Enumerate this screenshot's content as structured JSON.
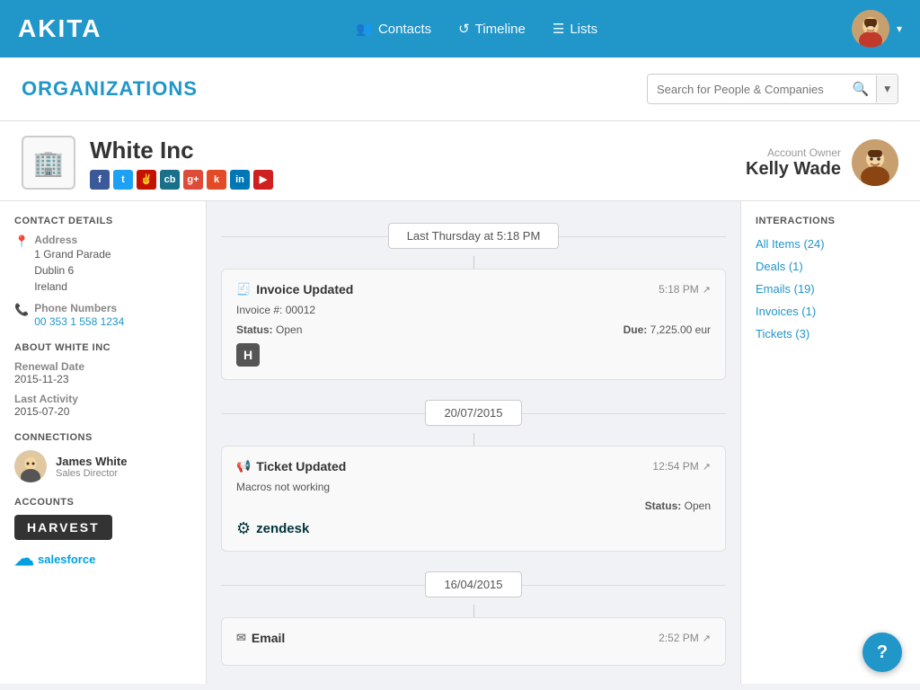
{
  "nav": {
    "logo": "AKITA",
    "links": [
      {
        "label": "Contacts",
        "icon": "👥"
      },
      {
        "label": "Timeline",
        "icon": "↺"
      },
      {
        "label": "Lists",
        "icon": "☰"
      }
    ]
  },
  "header": {
    "page_title": "ORGANIZATIONS",
    "search_placeholder": "Search for People & Companies"
  },
  "company": {
    "name": "White Inc",
    "icon": "🏢",
    "account_owner_label": "Account Owner",
    "account_owner": "Kelly Wade"
  },
  "left_sidebar": {
    "contact_details_title": "CONTACT DETAILS",
    "address_label": "Address",
    "address_line1": "1 Grand Parade",
    "address_line2": "Dublin 6",
    "address_line3": "Ireland",
    "phone_label": "Phone Numbers",
    "phone_number": "00 353 1 558 1234",
    "about_title": "ABOUT WHITE INC",
    "renewal_date_label": "Renewal Date",
    "renewal_date": "2015-11-23",
    "last_activity_label": "Last Activity",
    "last_activity": "2015-07-20",
    "connections_title": "CONNECTIONS",
    "connection_name": "James White",
    "connection_title": "Sales Director",
    "accounts_title": "ACCOUNTS",
    "harvest_label": "HARVEST",
    "salesforce_label": "salesforce"
  },
  "timeline": {
    "date_badge_1": "Last Thursday at 5:18 PM",
    "card1": {
      "title": "Invoice Updated",
      "time": "5:18 PM",
      "invoice_num": "Invoice #: 00012",
      "status_label": "Status:",
      "status_value": "Open",
      "due_label": "Due:",
      "due_value": "7,225.00 eur"
    },
    "date_badge_2": "20/07/2015",
    "card2": {
      "title": "Ticket Updated",
      "time": "12:54 PM",
      "description": "Macros not working",
      "status_label": "Status:",
      "status_value": "Open"
    },
    "date_badge_3": "16/04/2015",
    "card3": {
      "title": "Email",
      "time": "2:52 PM"
    }
  },
  "interactions": {
    "title": "INTERACTIONS",
    "links": [
      {
        "label": "All Items (24)"
      },
      {
        "label": "Deals (1)"
      },
      {
        "label": "Emails (19)"
      },
      {
        "label": "Invoices (1)"
      },
      {
        "label": "Tickets (3)"
      }
    ]
  },
  "help_btn": "?"
}
